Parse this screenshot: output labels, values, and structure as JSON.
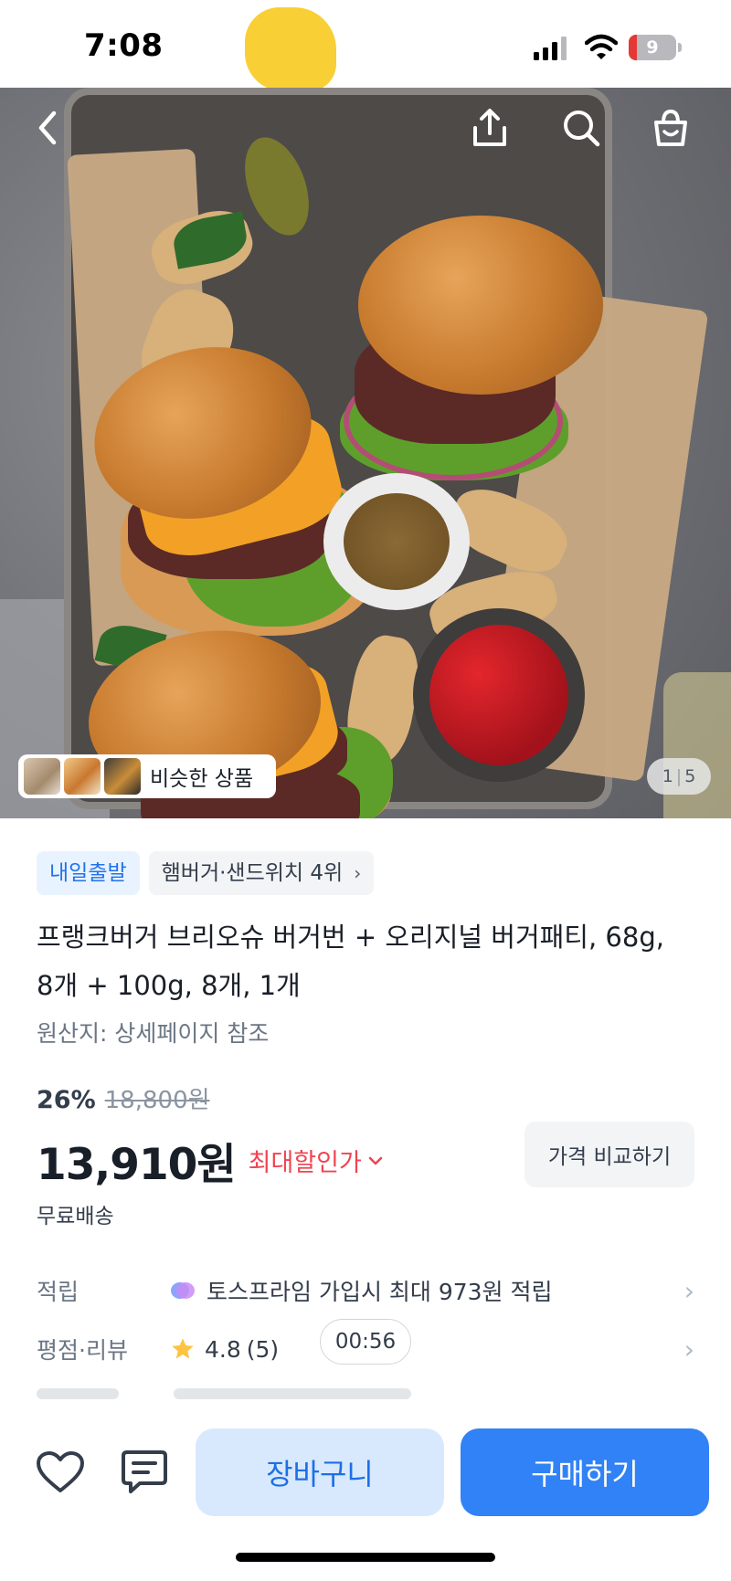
{
  "status_bar": {
    "time": "7:08",
    "battery_level": "9",
    "icons": [
      "signal-icon",
      "wifi-icon",
      "battery-icon"
    ]
  },
  "gallery": {
    "similar_label": "비슷한 상품",
    "page_current": "1",
    "page_total": "5",
    "icons": [
      "chevron-left-icon",
      "share-icon",
      "search-icon",
      "shopping-bag-icon"
    ]
  },
  "product": {
    "tag_shipping": "내일출발",
    "tag_rank": "햄버거·샌드위치 4위",
    "title": "프랭크버거 브리오슈 버거번 + 오리지널 버거패티, 68g, 8개 + 100g, 8개, 1개",
    "origin": "원산지: 상세페이지 참조",
    "discount_percent": "26%",
    "original_price": "18,800원",
    "price": "13,910원",
    "max_discount_label": "최대할인가",
    "compare_button": "가격 비교하기",
    "shipping": "무료배송"
  },
  "info_rows": {
    "points_label": "적립",
    "points_value": "토스프라임 가입시 최대 973원 적립",
    "rating_label": "평점·리뷰",
    "rating_value": "4.8",
    "review_count": "(5)",
    "timer": "00:56"
  },
  "actions": {
    "cart_label": "장바구니",
    "buy_label": "구매하기",
    "icons": [
      "heart-icon",
      "chat-icon"
    ]
  },
  "colors": {
    "primary": "#3182f6",
    "primary_light": "#d8e9fd",
    "discount_red": "#f04452",
    "star": "#ffc342",
    "tag_blue": "#2272eb"
  }
}
